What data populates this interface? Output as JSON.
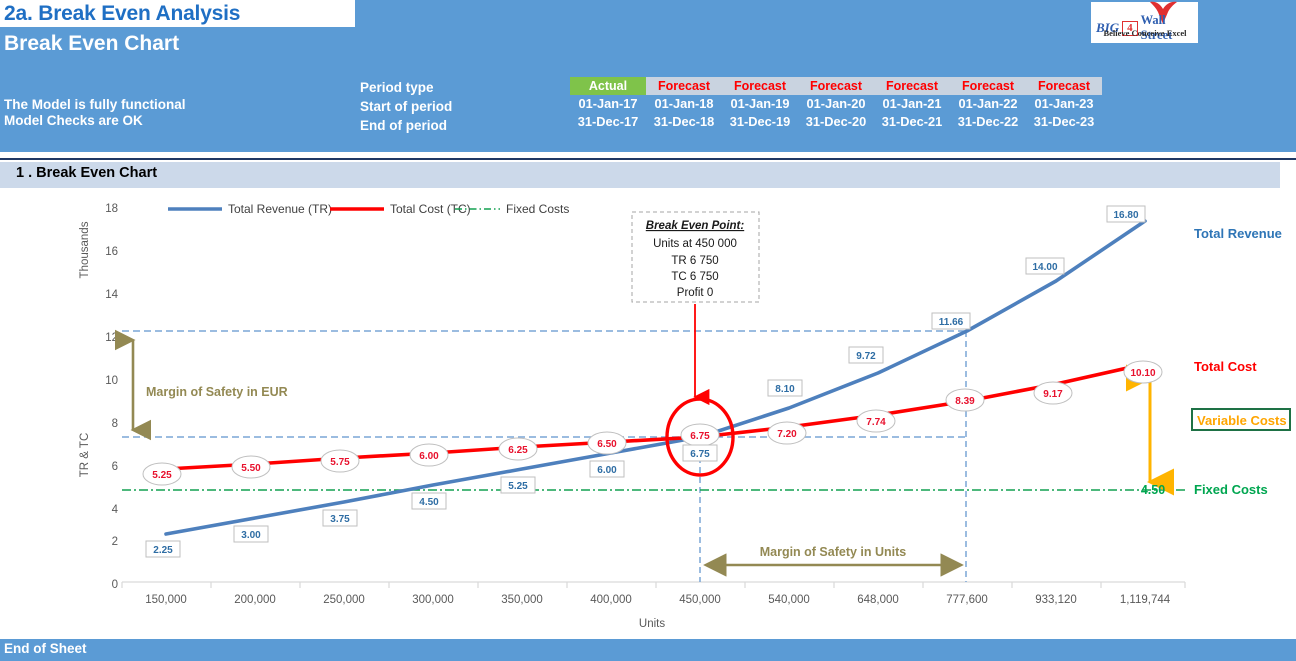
{
  "header": {
    "tab_title": "2a. Break Even Analysis",
    "sheet_title": "Break Even Chart",
    "model_status_1": "The Model is fully functional",
    "model_status_2": "Model Checks are OK",
    "accent_blue": "#5b9bd5",
    "title_blue": "#1f6fc4"
  },
  "logo": {
    "word_big": "BIG",
    "word_num": "4",
    "word_wall_street": "Wall Street",
    "tagline": "Believe Conceive Excel",
    "bird_color": "#e03030"
  },
  "period_table": {
    "row_labels": [
      "Period type",
      "Start of period",
      "End of period"
    ],
    "period_types": [
      "Actual",
      "Forecast",
      "Forecast",
      "Forecast",
      "Forecast",
      "Forecast",
      "Forecast"
    ],
    "start_of_period": [
      "01-Jan-17",
      "01-Jan-18",
      "01-Jan-19",
      "01-Jan-20",
      "01-Jan-21",
      "01-Jan-22",
      "01-Jan-23"
    ],
    "end_of_period": [
      "31-Dec-17",
      "31-Dec-18",
      "31-Dec-19",
      "31-Dec-20",
      "31-Dec-21",
      "31-Dec-22",
      "31-Dec-23"
    ],
    "actual_color": "#7fc34a",
    "forecast_color": "#ff0000"
  },
  "section": {
    "heading": "1 .  Break Even Chart"
  },
  "chart_data": {
    "type": "line",
    "title": "Break Even Chart",
    "xlabel": "Units",
    "ylabel": "TR & TC",
    "y_unit_label": "Thousands",
    "ylim": [
      0,
      18
    ],
    "yticks": [
      0,
      2,
      4,
      6,
      8,
      10,
      12,
      14,
      16,
      18
    ],
    "grid": false,
    "legend_position": "top",
    "categories": [
      "150,000",
      "200,000",
      "250,000",
      "300,000",
      "350,000",
      "400,000",
      "450,000",
      "540,000",
      "648,000",
      "777,600",
      "933,120",
      "1,119,744"
    ],
    "series": [
      {
        "name": "Total Revenue (TR)",
        "color": "#4e80bd",
        "style": "solid",
        "values": [
          2.25,
          3.0,
          3.75,
          4.5,
          5.25,
          6.0,
          6.75,
          8.1,
          9.72,
          11.66,
          14.0,
          16.8
        ],
        "labels": [
          "2.25",
          "3.00",
          "3.75",
          "4.50",
          "5.25",
          "6.00",
          "6.75",
          "8.10",
          "9.72",
          "11.66",
          "14.00",
          "16.80"
        ]
      },
      {
        "name": "Total Cost (TC)",
        "color": "#ff0000",
        "style": "solid",
        "values": [
          5.25,
          5.5,
          5.75,
          6.0,
          6.25,
          6.5,
          6.75,
          7.2,
          7.74,
          8.39,
          9.17,
          10.1
        ],
        "labels": [
          "5.25",
          "5.50",
          "5.75",
          "6.00",
          "6.25",
          "6.50",
          "6.75",
          "7.20",
          "7.74",
          "8.39",
          "9.17",
          "10.10"
        ]
      },
      {
        "name": "Fixed Costs",
        "color": "#12a050",
        "style": "dash-dot",
        "constant": 4.5,
        "values": [
          4.5,
          4.5,
          4.5,
          4.5,
          4.5,
          4.5,
          4.5,
          4.5,
          4.5,
          4.5,
          4.5,
          4.5
        ]
      }
    ],
    "annotations": {
      "break_even_title": "Break Even Point:",
      "break_even_units": "Units at 450 000",
      "break_even_tr": "TR 6 750",
      "break_even_tc": "TC 6 750",
      "break_even_profit": "Profit 0",
      "break_even_value_tc": "6.75",
      "break_even_value_tr": "6.75",
      "margin_of_safety_eur": "Margin of Safety in EUR",
      "margin_of_safety_units": "Margin of Safety in Units",
      "fixed_cost_value": "4.50",
      "mos_color": "#938953",
      "refline_upper": 11.66,
      "refline_lower": 6.75,
      "vline_left": "450,000",
      "vline_right": "777,600"
    },
    "right_labels": {
      "total_revenue": "Total Revenue",
      "total_cost": "Total Cost",
      "variable_costs": "Variable Costs",
      "fixed_costs": "Fixed Costs",
      "variable_box_border": "#1e7145",
      "variable_arrow_color": "#ffb400"
    }
  },
  "footer": {
    "text": "End of Sheet"
  }
}
